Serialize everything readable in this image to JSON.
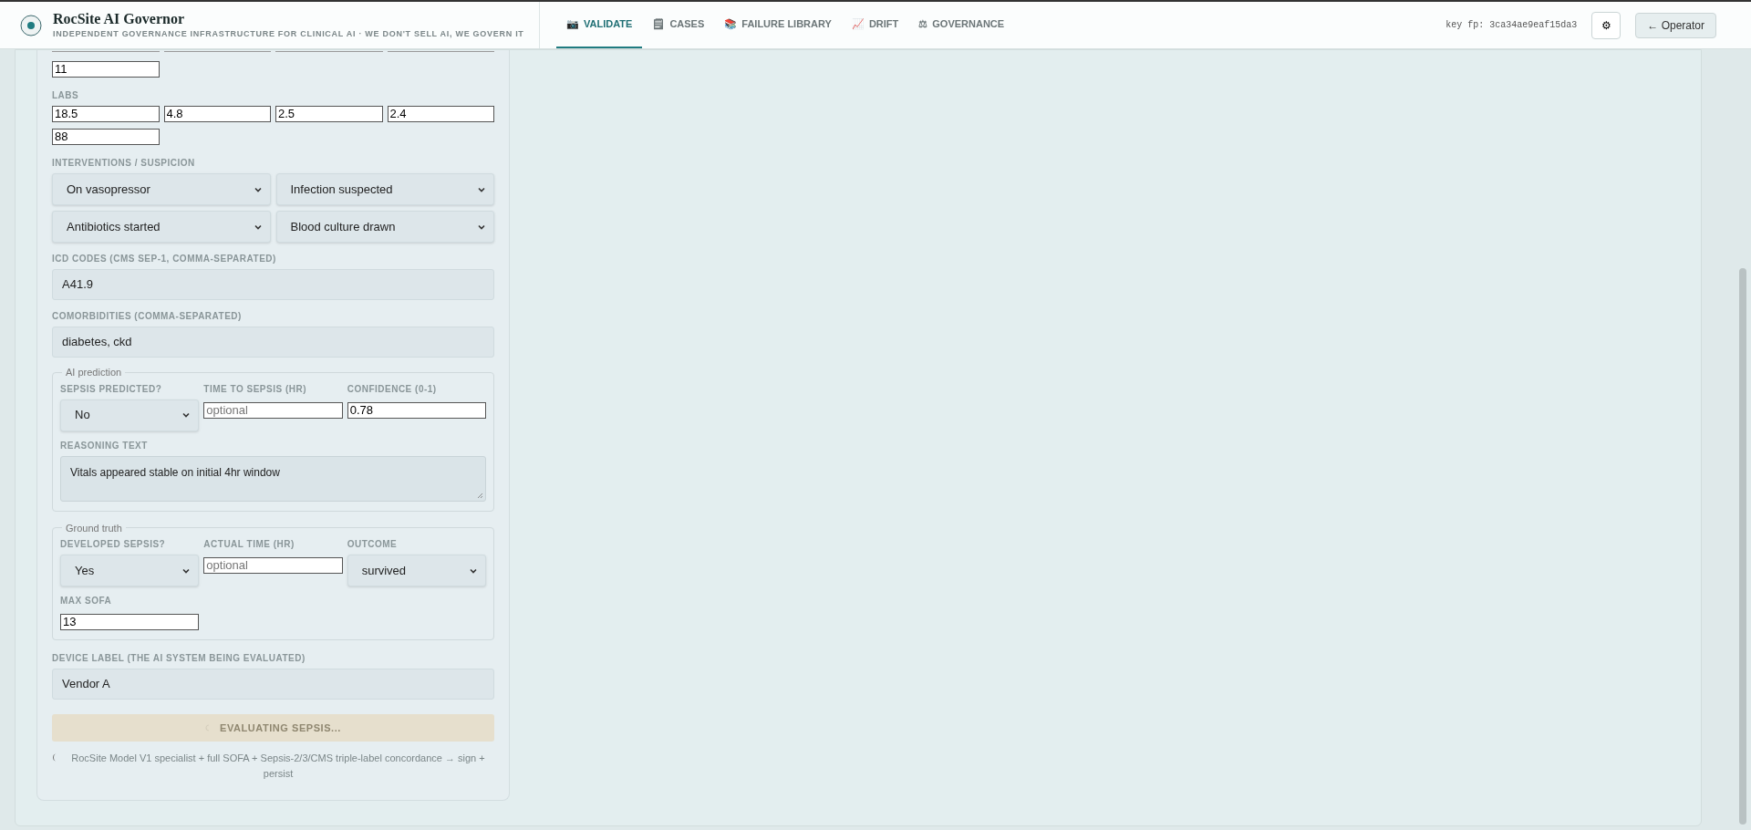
{
  "header": {
    "title": "RocSite AI Governor",
    "subtitle": "INDEPENDENT GOVERNANCE INFRASTRUCTURE FOR CLINICAL AI · WE DON'T SELL AI, WE GOVERN IT",
    "key_fp": "key fp: 3ca34ae9eaf15da3",
    "settings_icon": "⚙",
    "operator_button": "← Operator"
  },
  "tabs": [
    {
      "icon": "📷",
      "label": "VALIDATE",
      "selected": true
    },
    {
      "icon": "🗒",
      "label": "CASES",
      "selected": false
    },
    {
      "icon": "📚",
      "label": "FAILURE LIBRARY",
      "selected": false
    },
    {
      "icon": "📈",
      "label": "DRIFT",
      "selected": false
    },
    {
      "icon": "⚖",
      "label": "GOVERNANCE",
      "selected": false
    }
  ],
  "form": {
    "vitals_extra": {
      "value": "11"
    },
    "labs": {
      "label": "LABS",
      "values": [
        "18.5",
        "4.8",
        "2.5",
        "2.4",
        "88"
      ]
    },
    "interventions": {
      "label": "INTERVENTIONS / SUSPICION",
      "selects": [
        "On vasopressor",
        "Infection suspected",
        "Antibiotics started",
        "Blood culture drawn"
      ]
    },
    "icd_codes": {
      "label": "ICD CODES (CMS SEP-1, COMMA-SEPARATED)",
      "value": "A41.9"
    },
    "comorbidities": {
      "label": "COMORBIDITIES (COMMA-SEPARATED)",
      "value": "diabetes, ckd"
    },
    "ai_prediction": {
      "legend": "AI prediction",
      "fields": [
        {
          "kind": "select",
          "label": "SEPSIS PREDICTED?",
          "value": "No"
        },
        {
          "kind": "input",
          "label": "TIME TO SEPSIS (HR)",
          "placeholder": "optional"
        },
        {
          "kind": "input",
          "label": "CONFIDENCE (0-1)",
          "value": "0.78"
        }
      ],
      "reasoning": {
        "label": "REASONING TEXT",
        "value": "Vitals appeared stable on initial 4hr window"
      }
    },
    "ground_truth": {
      "legend": "Ground truth",
      "fields": [
        {
          "kind": "select",
          "label": "DEVELOPED SEPSIS?",
          "value": "Yes"
        },
        {
          "kind": "input",
          "label": "ACTUAL TIME (HR)",
          "placeholder": "optional"
        },
        {
          "kind": "select",
          "label": "OUTCOME",
          "value": "survived"
        },
        {
          "kind": "input",
          "label": "MAX SOFA",
          "value": "13"
        }
      ]
    },
    "device_label": {
      "label": "DEVICE LABEL (THE AI SYSTEM BEING EVALUATED)",
      "value": "Vendor A"
    },
    "submit": {
      "label": "EVALUATING SEPSIS...",
      "disabled": true
    },
    "footnote": "RocSite Model V1 specialist + full SOFA + Sepsis-2/3/CMS triple-label concordance → sign + persist"
  }
}
